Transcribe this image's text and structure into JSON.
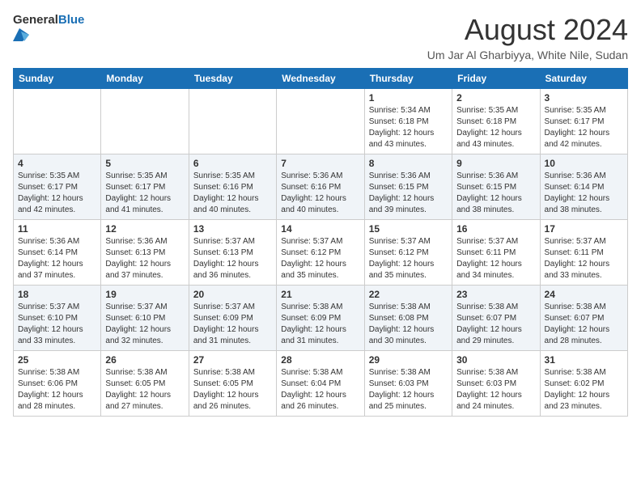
{
  "header": {
    "logo_general": "General",
    "logo_blue": "Blue",
    "month_year": "August 2024",
    "location": "Um Jar Al Gharbiyya, White Nile, Sudan"
  },
  "weekdays": [
    "Sunday",
    "Monday",
    "Tuesday",
    "Wednesday",
    "Thursday",
    "Friday",
    "Saturday"
  ],
  "weeks": [
    [
      {
        "date": "",
        "info": ""
      },
      {
        "date": "",
        "info": ""
      },
      {
        "date": "",
        "info": ""
      },
      {
        "date": "",
        "info": ""
      },
      {
        "date": "1",
        "info": "Sunrise: 5:34 AM\nSunset: 6:18 PM\nDaylight: 12 hours\nand 43 minutes."
      },
      {
        "date": "2",
        "info": "Sunrise: 5:35 AM\nSunset: 6:18 PM\nDaylight: 12 hours\nand 43 minutes."
      },
      {
        "date": "3",
        "info": "Sunrise: 5:35 AM\nSunset: 6:17 PM\nDaylight: 12 hours\nand 42 minutes."
      }
    ],
    [
      {
        "date": "4",
        "info": "Sunrise: 5:35 AM\nSunset: 6:17 PM\nDaylight: 12 hours\nand 42 minutes."
      },
      {
        "date": "5",
        "info": "Sunrise: 5:35 AM\nSunset: 6:17 PM\nDaylight: 12 hours\nand 41 minutes."
      },
      {
        "date": "6",
        "info": "Sunrise: 5:35 AM\nSunset: 6:16 PM\nDaylight: 12 hours\nand 40 minutes."
      },
      {
        "date": "7",
        "info": "Sunrise: 5:36 AM\nSunset: 6:16 PM\nDaylight: 12 hours\nand 40 minutes."
      },
      {
        "date": "8",
        "info": "Sunrise: 5:36 AM\nSunset: 6:15 PM\nDaylight: 12 hours\nand 39 minutes."
      },
      {
        "date": "9",
        "info": "Sunrise: 5:36 AM\nSunset: 6:15 PM\nDaylight: 12 hours\nand 38 minutes."
      },
      {
        "date": "10",
        "info": "Sunrise: 5:36 AM\nSunset: 6:14 PM\nDaylight: 12 hours\nand 38 minutes."
      }
    ],
    [
      {
        "date": "11",
        "info": "Sunrise: 5:36 AM\nSunset: 6:14 PM\nDaylight: 12 hours\nand 37 minutes."
      },
      {
        "date": "12",
        "info": "Sunrise: 5:36 AM\nSunset: 6:13 PM\nDaylight: 12 hours\nand 37 minutes."
      },
      {
        "date": "13",
        "info": "Sunrise: 5:37 AM\nSunset: 6:13 PM\nDaylight: 12 hours\nand 36 minutes."
      },
      {
        "date": "14",
        "info": "Sunrise: 5:37 AM\nSunset: 6:12 PM\nDaylight: 12 hours\nand 35 minutes."
      },
      {
        "date": "15",
        "info": "Sunrise: 5:37 AM\nSunset: 6:12 PM\nDaylight: 12 hours\nand 35 minutes."
      },
      {
        "date": "16",
        "info": "Sunrise: 5:37 AM\nSunset: 6:11 PM\nDaylight: 12 hours\nand 34 minutes."
      },
      {
        "date": "17",
        "info": "Sunrise: 5:37 AM\nSunset: 6:11 PM\nDaylight: 12 hours\nand 33 minutes."
      }
    ],
    [
      {
        "date": "18",
        "info": "Sunrise: 5:37 AM\nSunset: 6:10 PM\nDaylight: 12 hours\nand 33 minutes."
      },
      {
        "date": "19",
        "info": "Sunrise: 5:37 AM\nSunset: 6:10 PM\nDaylight: 12 hours\nand 32 minutes."
      },
      {
        "date": "20",
        "info": "Sunrise: 5:37 AM\nSunset: 6:09 PM\nDaylight: 12 hours\nand 31 minutes."
      },
      {
        "date": "21",
        "info": "Sunrise: 5:38 AM\nSunset: 6:09 PM\nDaylight: 12 hours\nand 31 minutes."
      },
      {
        "date": "22",
        "info": "Sunrise: 5:38 AM\nSunset: 6:08 PM\nDaylight: 12 hours\nand 30 minutes."
      },
      {
        "date": "23",
        "info": "Sunrise: 5:38 AM\nSunset: 6:07 PM\nDaylight: 12 hours\nand 29 minutes."
      },
      {
        "date": "24",
        "info": "Sunrise: 5:38 AM\nSunset: 6:07 PM\nDaylight: 12 hours\nand 28 minutes."
      }
    ],
    [
      {
        "date": "25",
        "info": "Sunrise: 5:38 AM\nSunset: 6:06 PM\nDaylight: 12 hours\nand 28 minutes."
      },
      {
        "date": "26",
        "info": "Sunrise: 5:38 AM\nSunset: 6:05 PM\nDaylight: 12 hours\nand 27 minutes."
      },
      {
        "date": "27",
        "info": "Sunrise: 5:38 AM\nSunset: 6:05 PM\nDaylight: 12 hours\nand 26 minutes."
      },
      {
        "date": "28",
        "info": "Sunrise: 5:38 AM\nSunset: 6:04 PM\nDaylight: 12 hours\nand 26 minutes."
      },
      {
        "date": "29",
        "info": "Sunrise: 5:38 AM\nSunset: 6:03 PM\nDaylight: 12 hours\nand 25 minutes."
      },
      {
        "date": "30",
        "info": "Sunrise: 5:38 AM\nSunset: 6:03 PM\nDaylight: 12 hours\nand 24 minutes."
      },
      {
        "date": "31",
        "info": "Sunrise: 5:38 AM\nSunset: 6:02 PM\nDaylight: 12 hours\nand 23 minutes."
      }
    ]
  ]
}
